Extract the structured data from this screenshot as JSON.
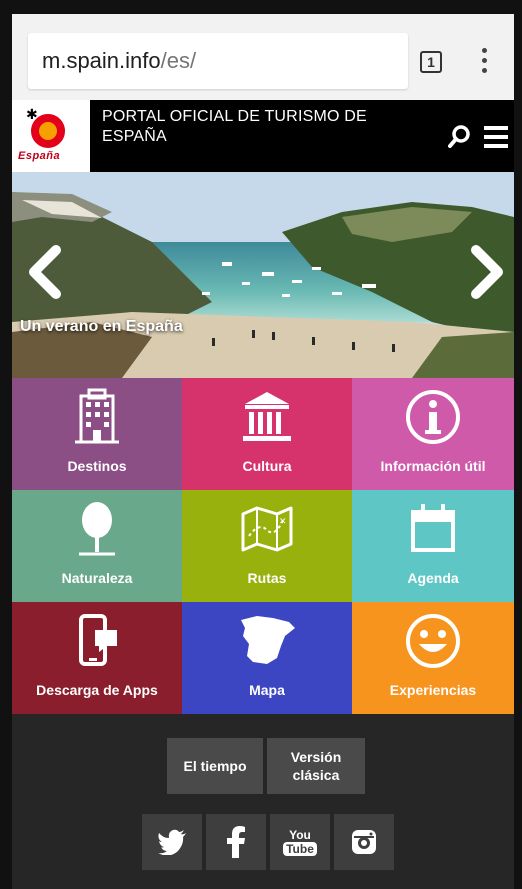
{
  "browser": {
    "url_host": "m.spain.info",
    "url_path": "/es/",
    "tab_count": "1"
  },
  "header": {
    "logo_text": "España",
    "title": "PORTAL OFICIAL DE TURISMO DE ESPAÑA"
  },
  "hero": {
    "caption": "Un verano en España"
  },
  "tiles": [
    {
      "label": "Destinos",
      "color": "#8b4f86",
      "icon": "building-icon"
    },
    {
      "label": "Cultura",
      "color": "#d6336c",
      "icon": "museum-icon"
    },
    {
      "label": "Información útil",
      "color": "#cf5aa9",
      "icon": "info-icon"
    },
    {
      "label": "Naturaleza",
      "color": "#6aa88b",
      "icon": "tree-icon"
    },
    {
      "label": "Rutas",
      "color": "#98b10d",
      "icon": "map-route-icon"
    },
    {
      "label": "Agenda",
      "color": "#5ec7c6",
      "icon": "calendar-icon"
    },
    {
      "label": "Descarga de Apps",
      "color": "#8a1e2d",
      "icon": "phone-chat-icon"
    },
    {
      "label": "Mapa",
      "color": "#3c45c2",
      "icon": "spain-map-icon"
    },
    {
      "label": "Experiencias",
      "color": "#f7941d",
      "icon": "smiley-icon"
    }
  ],
  "footer": {
    "weather_label": "El tiempo",
    "classic_label": "Versión clásica",
    "social": [
      "twitter-icon",
      "facebook-icon",
      "youtube-icon",
      "instagram-icon"
    ],
    "youtube_text_top": "You",
    "youtube_text_bottom": "Tube"
  }
}
